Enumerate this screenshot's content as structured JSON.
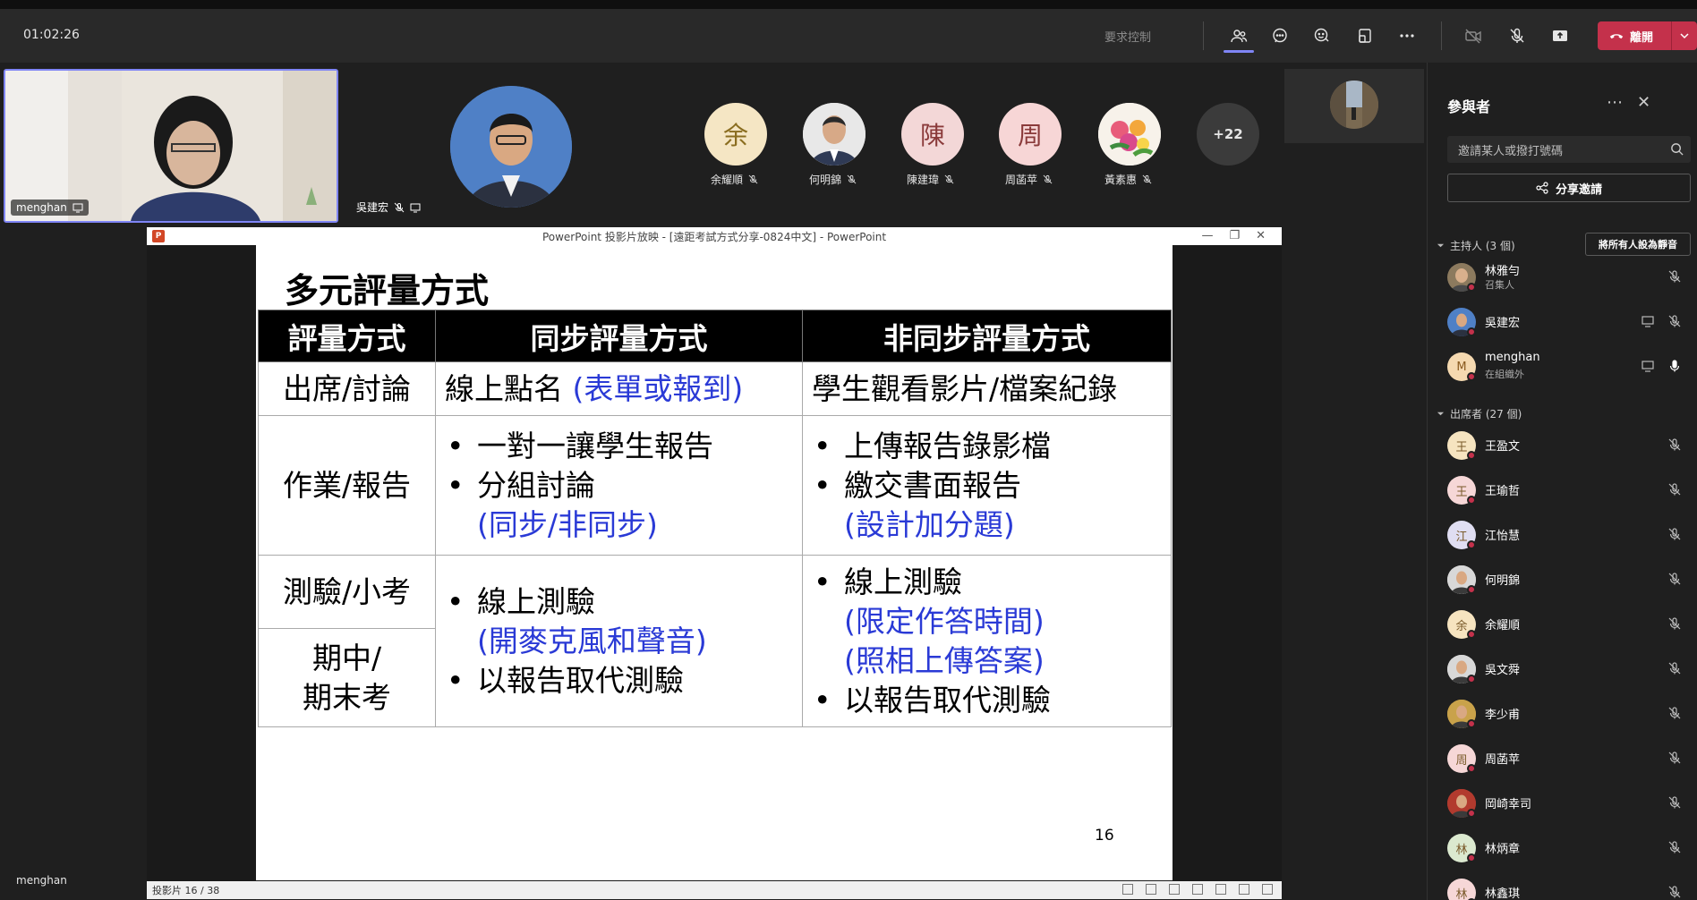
{
  "topbar": {
    "timer": "01:02:26",
    "request_control": "要求控制",
    "leave_label": "離開"
  },
  "colors": {
    "accent": "#7f85f5",
    "leave": "#c4314b",
    "slide_blue": "#2a3ad6"
  },
  "stage": {
    "self_name": "menghan",
    "presenter_name": "吳建宏",
    "participants": [
      {
        "initial": "余",
        "name": "余耀順",
        "bg": "#f5e6c4",
        "fg": "#8a6d1f"
      },
      {
        "initial": "",
        "name": "何明錦",
        "bg": "#ddd",
        "fg": "#333"
      },
      {
        "initial": "陳",
        "name": "陳建瑋",
        "bg": "#f3d7d7",
        "fg": "#8a3a3a"
      },
      {
        "initial": "周",
        "name": "周菡苹",
        "bg": "#f7d6d6",
        "fg": "#8a3a3a"
      },
      {
        "initial": "",
        "name": "黃素惠",
        "bg": "#f0f0f0",
        "fg": "#333"
      }
    ],
    "more_count": "+22",
    "bottom_name": "menghan"
  },
  "ppt": {
    "window_title": "PowerPoint 投影片放映 - [遠距考試方式分享-0824中文] - PowerPoint",
    "slide_title": "多元評量方式",
    "headers": [
      "評量方式",
      "同步評量方式",
      "非同步評量方式"
    ],
    "row1": {
      "type": "出席/討論",
      "sync_main": "線上點名 ",
      "sync_blue": "(表單或報到)",
      "async": "學生觀看影片/檔案紀錄"
    },
    "row2": {
      "type": "作業/報告",
      "sync": [
        "一對一讓學生報告",
        "分組討論"
      ],
      "sync_blue": "(同步/非同步)",
      "async": [
        "上傳報告錄影檔",
        "繳交書面報告"
      ],
      "async_blue": "(設計加分題)"
    },
    "row3": {
      "type_a": "測驗/小考",
      "type_b1": "期中/",
      "type_b2": "期末考",
      "sync_1": "線上測驗",
      "sync_blue": "(開麥克風和聲音)",
      "sync_2": "以報告取代測驗",
      "async_1": "線上測驗",
      "async_blue1": "(限定作答時間)",
      "async_blue2": "(照相上傳答案)",
      "async_2": "以報告取代測驗"
    },
    "slide_number": "16",
    "status_text": "投影片 16 / 38"
  },
  "panel": {
    "title": "參與者",
    "invite_placeholder": "邀請某人或撥打號碼",
    "share_invite": "分享邀請",
    "organizers_header": "主持人 (3 個)",
    "mute_all": "將所有人設為靜音",
    "organizers": [
      {
        "name": "林雅勻",
        "sub": "召集人",
        "initial": ""
      },
      {
        "name": "吳建宏",
        "sub": "",
        "initial": ""
      },
      {
        "name": "menghan",
        "sub": "在組織外",
        "initial": "M"
      }
    ],
    "attendees_header": "出席者 (27 個)",
    "attendees": [
      {
        "name": "王盈文",
        "initial": "王",
        "bg": "#f6e4c0"
      },
      {
        "name": "王瑜哲",
        "initial": "王",
        "bg": "#f6d7d7"
      },
      {
        "name": "江怡慧",
        "initial": "江",
        "bg": "#e0def2"
      },
      {
        "name": "何明錦",
        "initial": "",
        "bg": "#d8d8d8"
      },
      {
        "name": "余耀順",
        "initial": "余",
        "bg": "#f6e4c0"
      },
      {
        "name": "吳文舜",
        "initial": "",
        "bg": "#d8d8d8"
      },
      {
        "name": "李少甫",
        "initial": "",
        "bg": "#c9a24a"
      },
      {
        "name": "周菡苹",
        "initial": "周",
        "bg": "#f6d7d7"
      },
      {
        "name": "岡崎幸司",
        "initial": "",
        "bg": "#b23a2e"
      },
      {
        "name": "林炳章",
        "initial": "林",
        "bg": "#dbe9cf"
      },
      {
        "name": "林鑫琪",
        "initial": "林",
        "bg": "#f6d7d7"
      }
    ]
  }
}
